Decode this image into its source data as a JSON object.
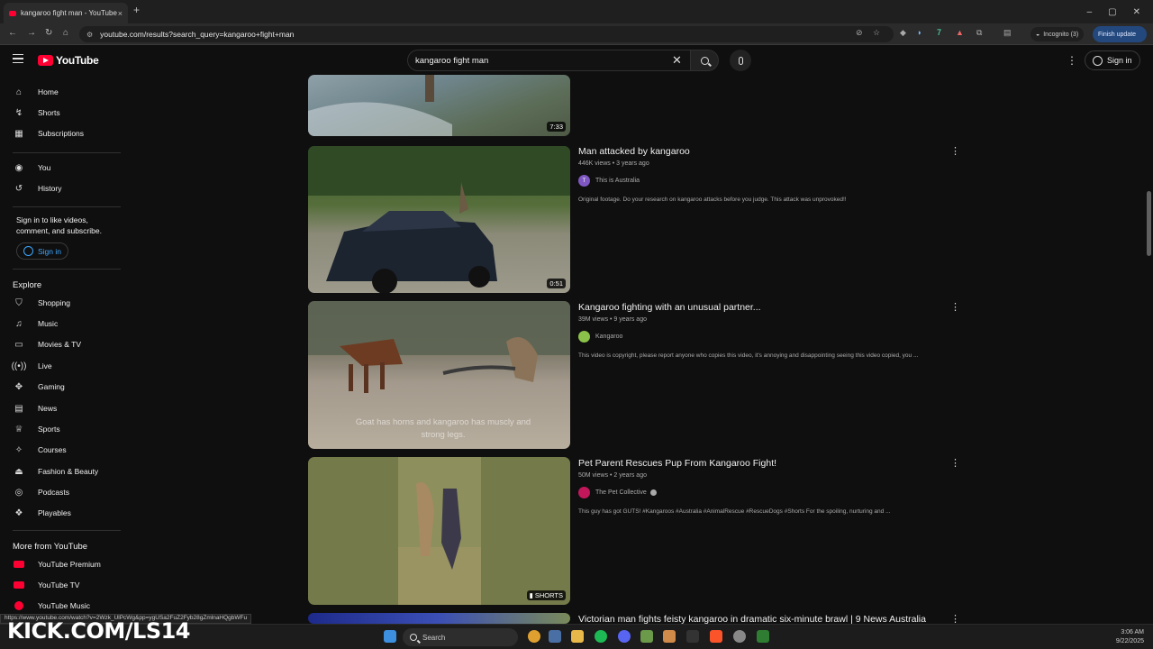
{
  "browser": {
    "tab_title": "kangaroo fight man - YouTube",
    "tab_close": "×",
    "new_tab": "+",
    "url": "youtube.com/results?search_query=kangaroo+fight+man",
    "incognito": "Incognito (3)",
    "finish_update": "Finish update",
    "status_url": "https://www.youtube.com/watch?v=2Wzk_UlPcWg&pp=ygUSa2FuZ2Fyb28gZmlnaHQgbWFu"
  },
  "header": {
    "logo": "YouTube",
    "search_value": "kangaroo fight man",
    "sign_in": "Sign in"
  },
  "sidebar": {
    "main": [
      "Home",
      "Shorts",
      "Subscriptions"
    ],
    "you": [
      "You",
      "History"
    ],
    "signin_note": "Sign in to like videos, comment, and subscribe.",
    "signin_button": "Sign in",
    "explore_title": "Explore",
    "explore": [
      "Shopping",
      "Music",
      "Movies & TV",
      "Live",
      "Gaming",
      "News",
      "Sports",
      "Courses",
      "Fashion & Beauty",
      "Podcasts",
      "Playables"
    ],
    "more_title": "More from YouTube",
    "more": [
      "YouTube Premium",
      "YouTube TV",
      "YouTube Music"
    ]
  },
  "results": [
    {
      "duration": "7:33"
    },
    {
      "title": "Man attacked by kangaroo",
      "meta": "446K views • 3 years ago",
      "channel": "This is Australia",
      "channel_initial": "T",
      "desc": "Original footage. Do your research on kangaroo attacks before you judge. This attack was unprovoked!!",
      "duration": "0:51"
    },
    {
      "title": "Kangaroo fighting with an unusual partner...",
      "meta": "39M views • 9 years ago",
      "channel": "Kangaroo",
      "desc": "This video is copyright, please report anyone who copies this video, it's annoying and disappointing seeing this video copied, you ...",
      "overlay": "Goat has horns and kangaroo has muscly and strong legs."
    },
    {
      "title": "Pet Parent Rescues Pup From Kangaroo Fight!",
      "meta": "50M views • 2 years ago",
      "channel": "The Pet Collective",
      "desc": "This guy has got GUTS! #Kangaroos #Australia #AnimalRescue #RescueDogs #Shorts For the spoiling, nurturing and ...",
      "badge": "SHORTS"
    },
    {
      "title": "Victorian man fights feisty kangaroo in dramatic six-minute brawl | 9 News Australia"
    }
  ],
  "overlay_brand": "KICK.COM/LS14",
  "taskbar": {
    "search": "Search",
    "time": "3:06 AM",
    "date": "9/22/2025"
  }
}
